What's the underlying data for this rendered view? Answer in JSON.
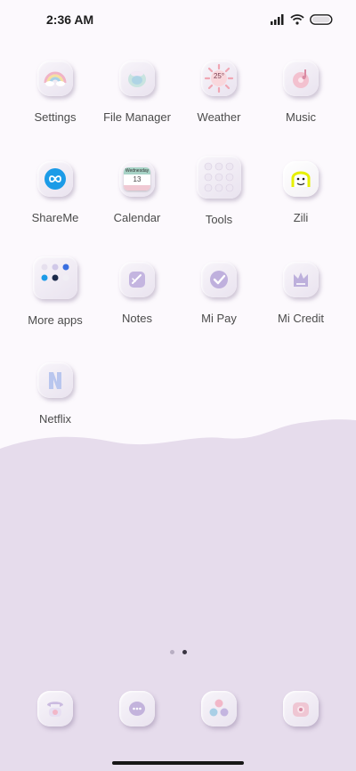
{
  "status_bar": {
    "time": "2:36 AM"
  },
  "apps": [
    {
      "label": "Settings",
      "icon": "settings-icon"
    },
    {
      "label": "File Manager",
      "icon": "file-manager-icon"
    },
    {
      "label": "Weather",
      "icon": "weather-icon",
      "badge_text": "25°"
    },
    {
      "label": "Music",
      "icon": "music-icon"
    },
    {
      "label": "ShareMe",
      "icon": "shareme-icon"
    },
    {
      "label": "Calendar",
      "icon": "calendar-icon",
      "weekday": "Wednesday",
      "date": "13"
    },
    {
      "label": "Tools",
      "icon": "tools-folder-icon"
    },
    {
      "label": "Zili",
      "icon": "zili-icon"
    },
    {
      "label": "More apps",
      "icon": "more-apps-folder-icon"
    },
    {
      "label": "Notes",
      "icon": "notes-icon"
    },
    {
      "label": "Mi Pay",
      "icon": "mi-pay-icon"
    },
    {
      "label": "Mi Credit",
      "icon": "mi-credit-icon"
    },
    {
      "label": "Netflix",
      "icon": "netflix-icon"
    }
  ],
  "pages": {
    "count": 2,
    "current": 2
  },
  "dock": [
    {
      "icon": "phone-icon"
    },
    {
      "icon": "messages-icon"
    },
    {
      "icon": "browser-icon"
    },
    {
      "icon": "camera-icon"
    }
  ],
  "colors": {
    "top_background": "#fcf9fd",
    "bottom_background": "#e6dcec",
    "text": "#4b4b4b"
  }
}
